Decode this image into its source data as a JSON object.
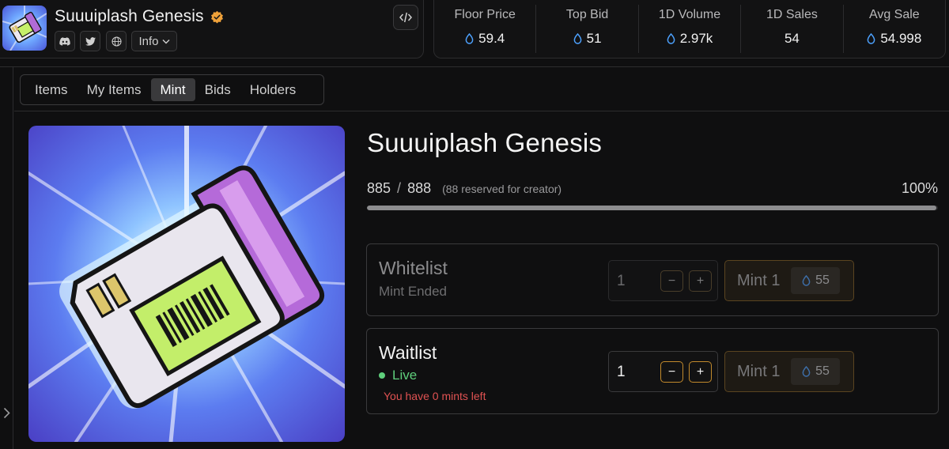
{
  "collection": {
    "name": "Suuuiplash Genesis",
    "info_label": "Info"
  },
  "stats": [
    {
      "label": "Floor Price",
      "value": "59.4",
      "currency_icon": true
    },
    {
      "label": "Top Bid",
      "value": "51",
      "currency_icon": true
    },
    {
      "label": "1D Volume",
      "value": "2.97k",
      "currency_icon": true
    },
    {
      "label": "1D Sales",
      "value": "54",
      "currency_icon": false
    },
    {
      "label": "Avg Sale",
      "value": "54.998",
      "currency_icon": true
    }
  ],
  "tabs": [
    {
      "label": "Items",
      "active": false
    },
    {
      "label": "My Items",
      "active": false
    },
    {
      "label": "Mint",
      "active": true
    },
    {
      "label": "Bids",
      "active": false
    },
    {
      "label": "Holders",
      "active": false
    }
  ],
  "mint": {
    "title": "Suuuiplash Genesis",
    "minted": "885",
    "separator": "/",
    "total": "888",
    "reserved_note": "(88 reserved for creator)",
    "percent": "100%",
    "progress_fraction": 0.997,
    "phases": {
      "whitelist": {
        "name": "Whitelist",
        "status": "Mint Ended",
        "quantity": "1",
        "minus": "−",
        "plus": "+",
        "button_label": "Mint 1",
        "price": "55"
      },
      "waitlist": {
        "name": "Waitlist",
        "status": "Live",
        "note": "You have 0 mints left",
        "quantity": "1",
        "minus": "−",
        "plus": "+",
        "button_label": "Mint 1",
        "price": "55"
      }
    }
  },
  "colors": {
    "accent_orange": "#c28a2c",
    "live_green": "#5fcf7c",
    "error_red": "#e05252",
    "sui_blue": "#4da2ff"
  },
  "icons": [
    "verified-badge-icon",
    "discord-icon",
    "twitter-icon",
    "globe-icon",
    "chevron-down-icon",
    "code-embed-icon",
    "sui-drop-icon",
    "chevron-right-icon"
  ]
}
